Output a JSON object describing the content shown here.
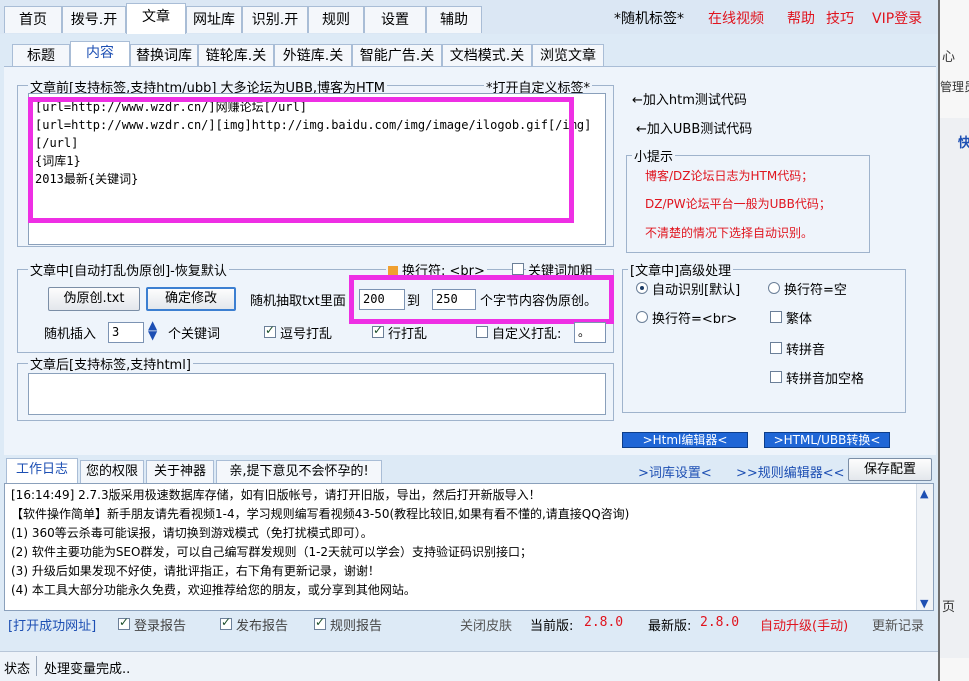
{
  "top_tabs": [
    "首页",
    "拨号.开",
    "文章",
    "网址库",
    "识别.开",
    "规则",
    "设置",
    "辅助"
  ],
  "top_links": {
    "random_tag": "*随机标签*",
    "video": "在线视频",
    "help": "帮助",
    "tips": "技巧",
    "vip": "VIP登录"
  },
  "sub_tabs": [
    "标题",
    "内容",
    "替换词库",
    "链轮库.关",
    "外链库.关",
    "智能广告.关",
    "文档模式.关",
    "浏览文章"
  ],
  "before": {
    "legend": "文章前[支持标签,支持htm/ubb] 大多论坛为UBB,博客为HTM",
    "custom_tag": "*打开自定义标签*",
    "lines": [
      "[url=http://www.wzdr.cn/]网赚论坛[/url]",
      "[url=http://www.wzdr.cn/][img]http://img.baidu.com/img/image/ilogob.gif[/img]",
      "[/url]",
      "{词库1}",
      "2013最新{关键词}"
    ]
  },
  "side": {
    "add_htm": "←加入htm测试代码",
    "add_ubb": "←加入UBB测试代码",
    "tips_legend": "小提示",
    "tips": [
      "博客/DZ论坛日志为HTM代码；",
      "DZ/PW论坛平台一般为UBB代码；",
      "不清楚的情况下选择自动识别。"
    ]
  },
  "middle": {
    "legend": "文章中[自动打乱伪原创]-恢复默认",
    "newline_label": "换行符: <br>",
    "keyword_bold": "关键词加粗",
    "btn_pseudo": "伪原创.txt",
    "btn_confirm": "确定修改",
    "random_label": "随机抽取txt里面",
    "from": "200",
    "to_label": "到",
    "to": "250",
    "bytes_label": "个字节内容伪原创。",
    "insert_label": "随机插入",
    "insert_value": "3",
    "insert_suffix": "个关键词",
    "comma_shuffle": "逗号打乱",
    "line_shuffle": "行打乱",
    "custom_shuffle": "自定义打乱:",
    "custom_shuffle_value": "。"
  },
  "advanced": {
    "legend": "[文章中]高级处理",
    "auto": "自动识别[默认]",
    "newline_empty": "换行符=空",
    "newline_br": "换行符=<br>",
    "traditional": "繁体",
    "pinyin": "转拼音",
    "pinyin_space": "转拼音加空格"
  },
  "after": {
    "legend": "文章后[支持标签,支持html]"
  },
  "nav_buttons": {
    "html_editor": ">Html编辑器<",
    "html_ubb": ">HTML/UBB转换<"
  },
  "log_tabs": [
    "工作日志",
    "您的权限",
    "关于神器",
    "亲,提下意见不会怀孕的!"
  ],
  "log_links": {
    "dict": ">词库设置<",
    "rules": ">>规则编辑器<<",
    "save": "保存配置"
  },
  "log_lines": [
    "[16:14:49] 2.7.3版采用极速数据库存储，如有旧版帐号，请打开旧版，导出，然后打开新版导入！",
    "【软件操作简单】新手朋友请先看视频1-4，学习规则编写看视频43-50(教程比较旧,如果有看不懂的,请直接QQ咨询)",
    "(1) 360等云杀毒可能误报，请切换到游戏模式（免打扰模式即可）。",
    "(2) 软件主要功能为SEO群发，可以自己编写群发规则（1-2天就可以学会）支持验证码识别接口；",
    "(3) 升级后如果发现不好使，请批评指正，右下角有更新记录，谢谢！",
    "(4) 本工具大部分功能永久免费，欢迎推荐给您的朋友，或分享到其他网站。"
  ],
  "bottom": {
    "open_url": "[打开成功网址]",
    "login_report": "登录报告",
    "publish_report": "发布报告",
    "rule_report": "规则报告",
    "close_skin": "关闭皮肤",
    "cur_label": "当前版:",
    "cur_ver": "2.8.0",
    "new_label": "最新版:",
    "new_ver": "2.8.0",
    "auto_upgrade": "自动升级(手动)",
    "changelog": "更新记录"
  },
  "status": {
    "label": "状态",
    "text": "处理变量完成.."
  },
  "right_strip": {
    "t1": "心",
    "t2": "管理员",
    "t3": "快",
    "t4": "页"
  }
}
